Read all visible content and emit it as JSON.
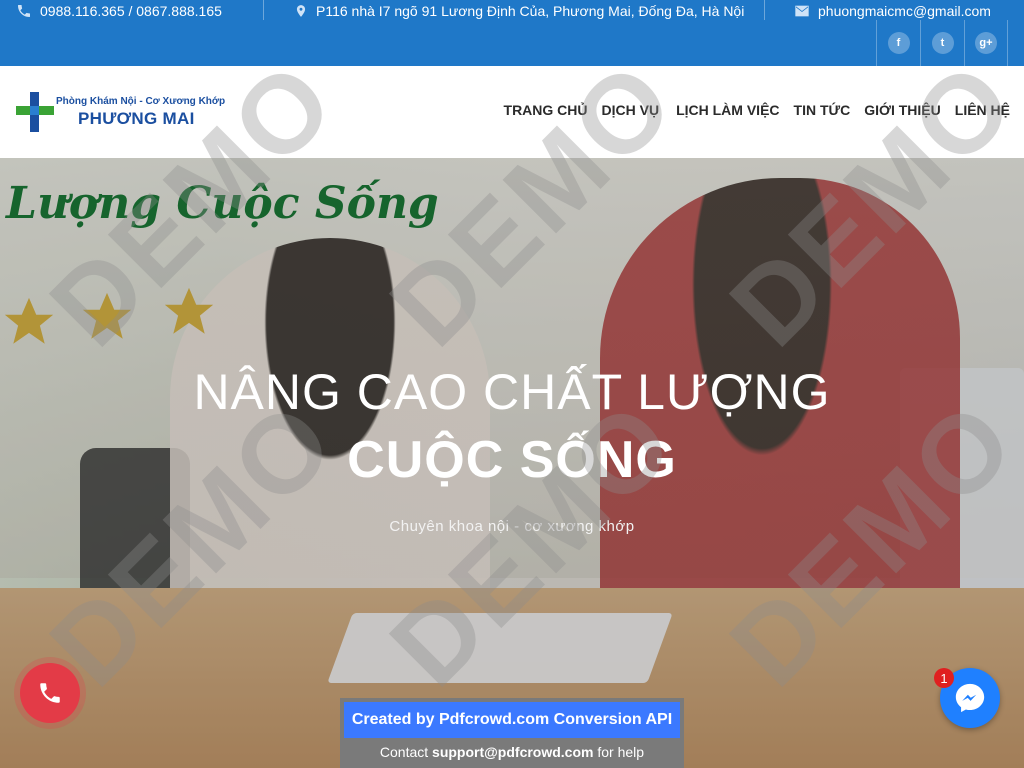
{
  "topbar": {
    "phone": "0988.116.365 / 0867.888.165",
    "address": "P116 nhà I7 ngõ 91 Lương Định Của, Phương Mai, Đống Đa, Hà Nội",
    "email": "phuongmaicmc@gmail.com",
    "social": [
      {
        "icon": "facebook-icon",
        "glyph": "f"
      },
      {
        "icon": "twitter-icon",
        "glyph": "t"
      },
      {
        "icon": "google-plus-icon",
        "glyph": "g+"
      }
    ]
  },
  "logo": {
    "line1": "Phòng Khám Nội - Cơ Xương Khớp",
    "line2": "PHƯƠNG MAI"
  },
  "nav": {
    "home": "TRANG CHỦ",
    "services": "DỊCH VỤ",
    "schedule": "LỊCH LÀM VIỆC",
    "news": "TIN TỨC",
    "about": "GIỚI THIỆU",
    "contact": "LIÊN HỆ"
  },
  "hero": {
    "cursive": "Lượng Cuộc Sống",
    "title_line1": "NÂNG CAO CHẤT LƯỢNG",
    "title_line2": "CUỘC SỐNG",
    "subtitle": "Chuyên khoa nội - cơ xương khớp"
  },
  "watermark": "DEMO",
  "messenger": {
    "badge": "1"
  },
  "pdfcrowd": {
    "created": "Created by Pdfcrowd.com Conversion API",
    "contact_prefix": "Contact ",
    "contact_email": "support@pdfcrowd.com",
    "contact_suffix": " for help"
  },
  "colors": {
    "topbar": "#1f78c8",
    "brand_blue": "#1b4fa0",
    "brand_green": "#3aa335",
    "call": "#e33b47",
    "messenger": "#1f80ff"
  }
}
